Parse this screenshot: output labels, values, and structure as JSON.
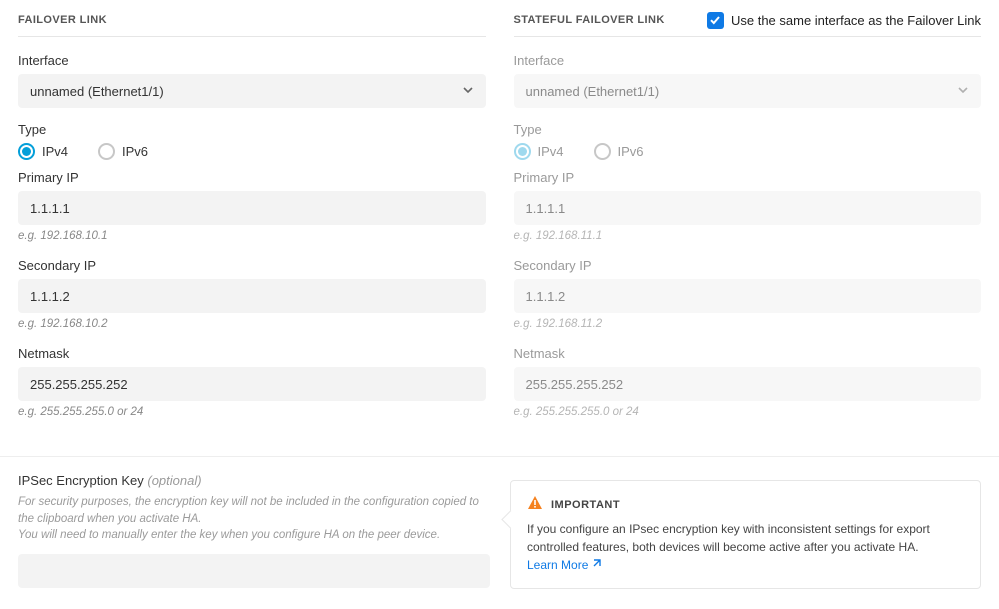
{
  "use_same_label": "Use the same interface as the Failover Link",
  "use_same_checked": true,
  "failover": {
    "title": "FAILOVER LINK",
    "interface_label": "Interface",
    "interface_value": "unnamed (Ethernet1/1)",
    "type_label": "Type",
    "type_options": {
      "ipv4": "IPv4",
      "ipv6": "IPv6"
    },
    "type_selected": "ipv4",
    "primary_ip_label": "Primary IP",
    "primary_ip_value": "1.1.1.1",
    "primary_ip_hint": "e.g. 192.168.10.1",
    "secondary_ip_label": "Secondary IP",
    "secondary_ip_value": "1.1.1.2",
    "secondary_ip_hint": "e.g. 192.168.10.2",
    "netmask_label": "Netmask",
    "netmask_value": "255.255.255.252",
    "netmask_hint": "e.g. 255.255.255.0 or 24"
  },
  "stateful": {
    "title": "STATEFUL FAILOVER LINK",
    "interface_label": "Interface",
    "interface_value": "unnamed (Ethernet1/1)",
    "type_label": "Type",
    "type_options": {
      "ipv4": "IPv4",
      "ipv6": "IPv6"
    },
    "type_selected": "ipv4",
    "primary_ip_label": "Primary IP",
    "primary_ip_value": "1.1.1.1",
    "primary_ip_hint": "e.g. 192.168.11.1",
    "secondary_ip_label": "Secondary IP",
    "secondary_ip_value": "1.1.1.2",
    "secondary_ip_hint": "e.g. 192.168.11.2",
    "netmask_label": "Netmask",
    "netmask_value": "255.255.255.252",
    "netmask_hint": "e.g. 255.255.255.0 or 24"
  },
  "ipsec": {
    "label": "IPSec Encryption Key",
    "optional": "(optional)",
    "note1": "For security purposes, the encryption key will not be included in the configuration copied to the clipboard when you activate HA.",
    "note2": "You will need to manually enter the key when you configure HA on the peer device.",
    "value": ""
  },
  "important": {
    "heading": "IMPORTANT",
    "body": "If you configure an IPsec encryption key with inconsistent settings for export controlled features, both devices will become active after you activate HA.",
    "learn_more": "Learn More"
  }
}
